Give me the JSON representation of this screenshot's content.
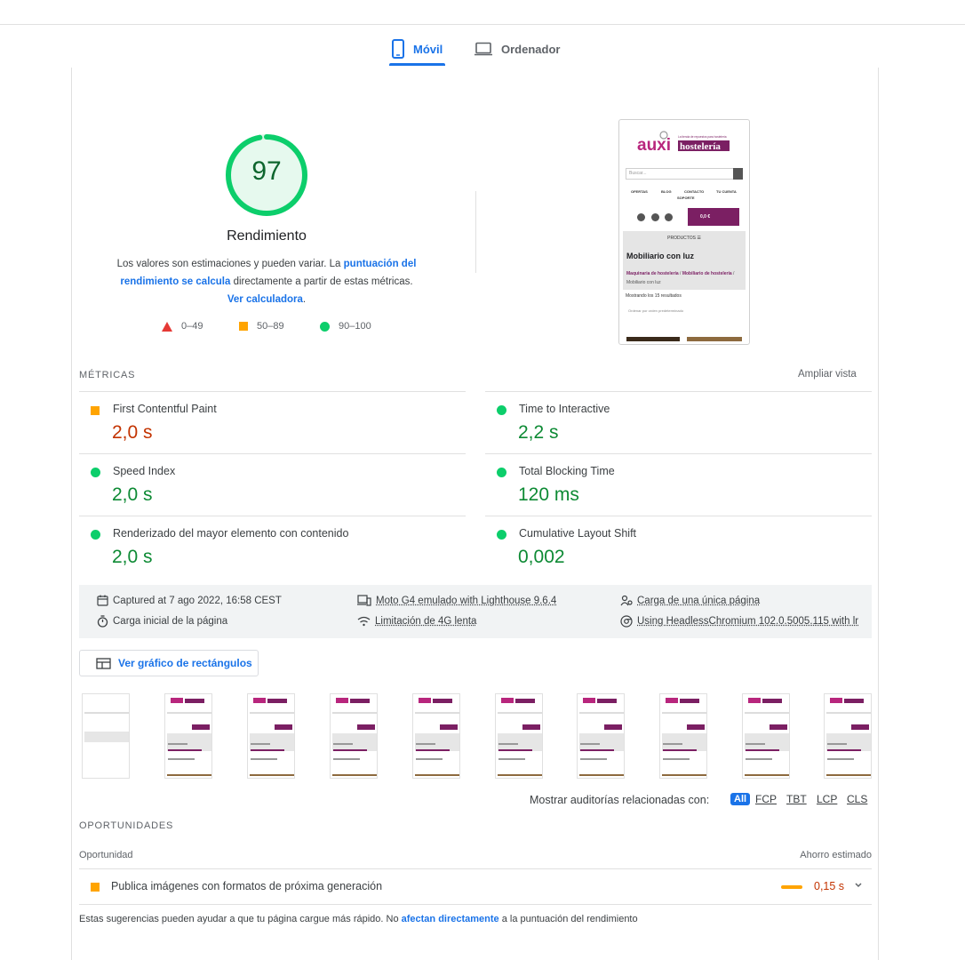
{
  "tabs": [
    {
      "label": "Móvil",
      "active": true,
      "icon": "smartphone-icon"
    },
    {
      "label": "Ordenador",
      "active": false,
      "icon": "laptop-icon"
    }
  ],
  "score": {
    "value": "97",
    "fraction": 0.97,
    "title": "Rendimiento",
    "desc_prefix": "Los valores son estimaciones y pueden variar. La ",
    "desc_link1": "puntuación del rendimiento se calcula",
    "desc_middle": " directamente a partir de estas métricas. ",
    "desc_link2": "Ver calculadora",
    "desc_suffix": "."
  },
  "legend": [
    {
      "range": "0–49",
      "shape": "triangle",
      "color": "#e53935"
    },
    {
      "range": "50–89",
      "shape": "square",
      "color": "#ffa400"
    },
    {
      "range": "90–100",
      "shape": "circle",
      "color": "#0cce6b"
    }
  ],
  "preview": {
    "logo_main": "auxi",
    "logo_sub": "hostelería",
    "logo_tag": "La tienda de repuestos para hostelería",
    "search_placeholder": "Buscar...",
    "nav": [
      "OFERTAS",
      "BLOG",
      "CONTACTO",
      "TU CUENTA",
      "SOPORTE"
    ],
    "cart": "0,0 €",
    "products": "PRODUCTOS",
    "heading": "Mobiliario con luz",
    "breadcrumb_a": "Maquinaria de hostelería",
    "breadcrumb_b": "Mobiliario de hostelería",
    "breadcrumb_current": "Mobiliario con luz",
    "results": "Mostrando los 15 resultados",
    "sort": "Ordenar por orden predeterminado"
  },
  "metrics": {
    "label": "MÉTRICAS",
    "expand": "Ampliar vista",
    "items": [
      {
        "name": "First Contentful Paint",
        "value": "2,0 s",
        "status": "average"
      },
      {
        "name": "Time to Interactive",
        "value": "2,2 s",
        "status": "pass"
      },
      {
        "name": "Speed Index",
        "value": "2,0 s",
        "status": "pass"
      },
      {
        "name": "Total Blocking Time",
        "value": "120 ms",
        "status": "pass"
      },
      {
        "name": "Renderizado del mayor elemento con contenido",
        "value": "2,0 s",
        "status": "pass"
      },
      {
        "name": "Cumulative Layout Shift",
        "value": "0,002",
        "status": "pass"
      }
    ]
  },
  "info": {
    "captured": "Captured at 7 ago 2022, 16:58 CEST",
    "device": "Moto G4 emulado with Lighthouse 9.6.4",
    "session": "Carga de una única página",
    "initial": "Carga inicial de la página",
    "throttle": "Limitación de 4G lenta",
    "browser": "Using HeadlessChromium 102.0.5005.115 with lr"
  },
  "treemap_label": "Ver gráfico de rectángulos",
  "filter": {
    "label": "Mostrar auditorías relacionadas con:",
    "all": "All",
    "chips": [
      "FCP",
      "TBT",
      "LCP",
      "CLS"
    ]
  },
  "opportunities": {
    "label": "OPORTUNIDADES",
    "col_left": "Oportunidad",
    "col_right": "Ahorro estimado",
    "items": [
      {
        "title": "Publica imágenes con formatos de próxima generación",
        "saving": "0,15 s"
      }
    ],
    "note_prefix": "Estas sugerencias pueden ayudar a que tu página cargue más rápido. No ",
    "note_link": "afectan directamente",
    "note_suffix": " a la puntuación del rendimiento"
  },
  "colors": {
    "accent": "#1a73e8",
    "pass": "#0cce6b",
    "average": "#ffa400",
    "fail": "#e53935",
    "brand": "#7b1f63"
  }
}
